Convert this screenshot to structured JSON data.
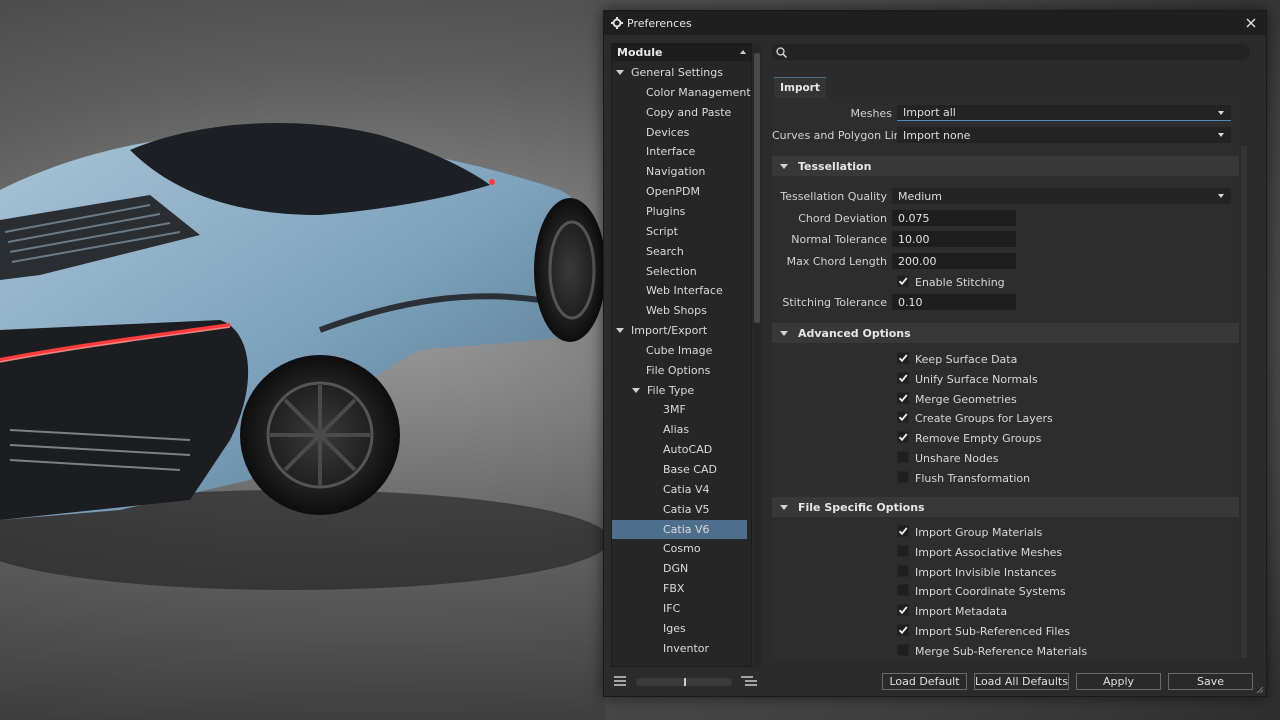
{
  "window": {
    "title": "Preferences"
  },
  "tree": {
    "header": "Module",
    "items": [
      {
        "label": "General Settings",
        "level": 0,
        "expanded": true
      },
      {
        "label": "Color Management",
        "level": 1
      },
      {
        "label": "Copy and Paste",
        "level": 1
      },
      {
        "label": "Devices",
        "level": 1
      },
      {
        "label": "Interface",
        "level": 1
      },
      {
        "label": "Navigation",
        "level": 1
      },
      {
        "label": "OpenPDM",
        "level": 1
      },
      {
        "label": "Plugins",
        "level": 1
      },
      {
        "label": "Script",
        "level": 1
      },
      {
        "label": "Search",
        "level": 1
      },
      {
        "label": "Selection",
        "level": 1
      },
      {
        "label": "Web Interface",
        "level": 1
      },
      {
        "label": "Web Shops",
        "level": 1
      },
      {
        "label": "Import/Export",
        "level": 0,
        "expanded": true
      },
      {
        "label": "Cube Image",
        "level": 1
      },
      {
        "label": "File Options",
        "level": 1
      },
      {
        "label": "File Type",
        "level": 1,
        "expanded": true
      },
      {
        "label": "3MF",
        "level": 2
      },
      {
        "label": "Alias",
        "level": 2
      },
      {
        "label": "AutoCAD",
        "level": 2
      },
      {
        "label": "Base CAD",
        "level": 2
      },
      {
        "label": "Catia V4",
        "level": 2
      },
      {
        "label": "Catia V5",
        "level": 2
      },
      {
        "label": "Catia V6",
        "level": 2,
        "selected": true
      },
      {
        "label": "Cosmo",
        "level": 2
      },
      {
        "label": "DGN",
        "level": 2
      },
      {
        "label": "FBX",
        "level": 2
      },
      {
        "label": "IFC",
        "level": 2
      },
      {
        "label": "Iges",
        "level": 2
      },
      {
        "label": "Inventor",
        "level": 2
      }
    ]
  },
  "search": {
    "placeholder": ""
  },
  "tabs": [
    {
      "label": "Import"
    }
  ],
  "import": {
    "meshes_label": "Meshes",
    "meshes_value": "Import all",
    "curves_label": "Curves and Polygon Lines",
    "curves_value": "Import none"
  },
  "tessellation": {
    "title": "Tessellation",
    "quality_label": "Tessellation Quality",
    "quality_value": "Medium",
    "chord_label": "Chord Deviation",
    "chord_value": "0.075",
    "normal_label": "Normal Tolerance",
    "normal_value": "10.00",
    "max_chord_label": "Max Chord Length",
    "max_chord_value": "200.00",
    "enable_stitching": {
      "label": "Enable Stitching",
      "checked": true
    },
    "stitching_tol_label": "Stitching Tolerance",
    "stitching_tol_value": "0.10"
  },
  "advanced": {
    "title": "Advanced Options",
    "options": [
      {
        "label": "Keep Surface Data",
        "checked": true
      },
      {
        "label": "Unify Surface Normals",
        "checked": true
      },
      {
        "label": "Merge Geometries",
        "checked": true
      },
      {
        "label": "Create Groups for Layers",
        "checked": true
      },
      {
        "label": "Remove Empty Groups",
        "checked": true
      },
      {
        "label": "Unshare Nodes",
        "checked": false
      },
      {
        "label": "Flush Transformation",
        "checked": false
      }
    ]
  },
  "file_specific": {
    "title": "File Specific Options",
    "options": [
      {
        "label": "Import Group Materials",
        "checked": true
      },
      {
        "label": "Import Associative Meshes",
        "checked": false
      },
      {
        "label": "Import Invisible Instances",
        "checked": false
      },
      {
        "label": "Import Coordinate Systems",
        "checked": false
      },
      {
        "label": "Import Metadata",
        "checked": true
      },
      {
        "label": "Import Sub-Referenced Files",
        "checked": true
      },
      {
        "label": "Merge Sub-Reference Materials",
        "checked": false
      }
    ]
  },
  "buttons": {
    "load_default": "Load Default",
    "load_all_defaults": "Load All Defaults",
    "apply": "Apply",
    "save": "Save"
  },
  "colors": {
    "accent": "#4e6f8c",
    "window_bg": "#2b2b2b",
    "section_bg": "#383838",
    "car_body": "#7fa3bd",
    "tail_light": "#ff3a3a"
  }
}
